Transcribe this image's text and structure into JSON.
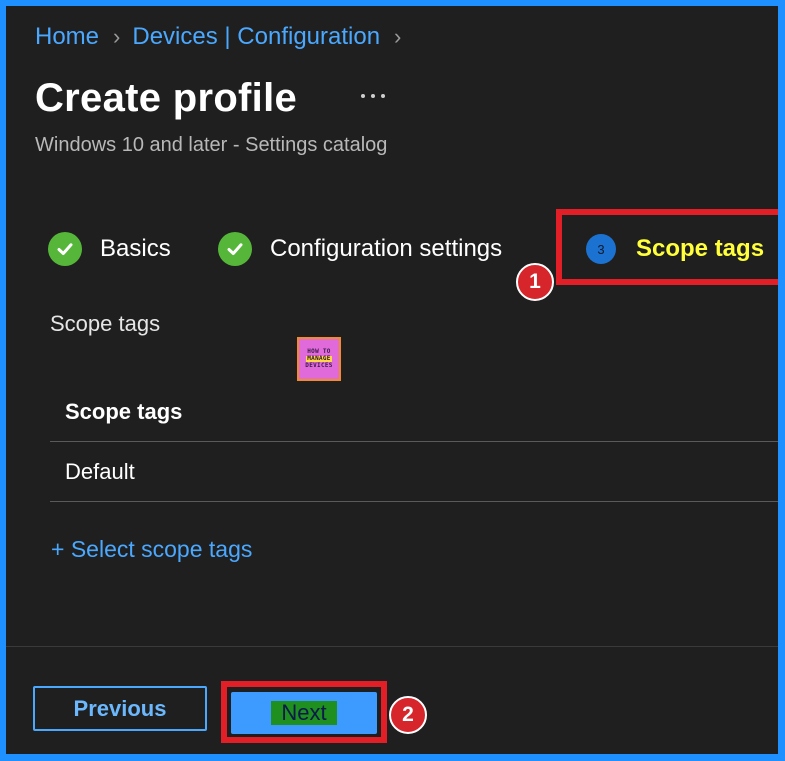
{
  "breadcrumb": {
    "items": [
      "Home",
      "Devices | Configuration"
    ],
    "separator": ">"
  },
  "page": {
    "title": "Create profile",
    "more_label": "...",
    "subtitle": "Windows 10 and later - Settings catalog"
  },
  "steps": [
    {
      "label": "Basics",
      "status": "completed"
    },
    {
      "label": "Configuration settings",
      "status": "completed"
    },
    {
      "number": "3",
      "label": "Scope tags",
      "status": "current"
    }
  ],
  "callouts": {
    "first": "1",
    "second": "2"
  },
  "scope_tags": {
    "section_label": "Scope tags",
    "column_header": "Scope tags",
    "rows": [
      "Default"
    ],
    "select_link": "+ Select scope tags"
  },
  "logo": {
    "line1": "HOW TO",
    "line2": "MANAGE",
    "line3": "DEVICES"
  },
  "footer": {
    "previous_label": "Previous",
    "next_label": "Next"
  },
  "colors": {
    "page_background": "#1f1f1f",
    "outer_border": "#1e90ff",
    "link": "#4aa8ff",
    "check_green": "#56b63a",
    "current_step_text": "#ffff3a",
    "annotation_red": "#e21f26",
    "next_button": "#3d9bff"
  },
  "icons": {
    "completed_step": "checkmark-circle-icon",
    "current_step": "numbered-circle-icon",
    "more": "more-ellipsis-icon",
    "breadcrumb_separator": "chevron-right-icon"
  }
}
